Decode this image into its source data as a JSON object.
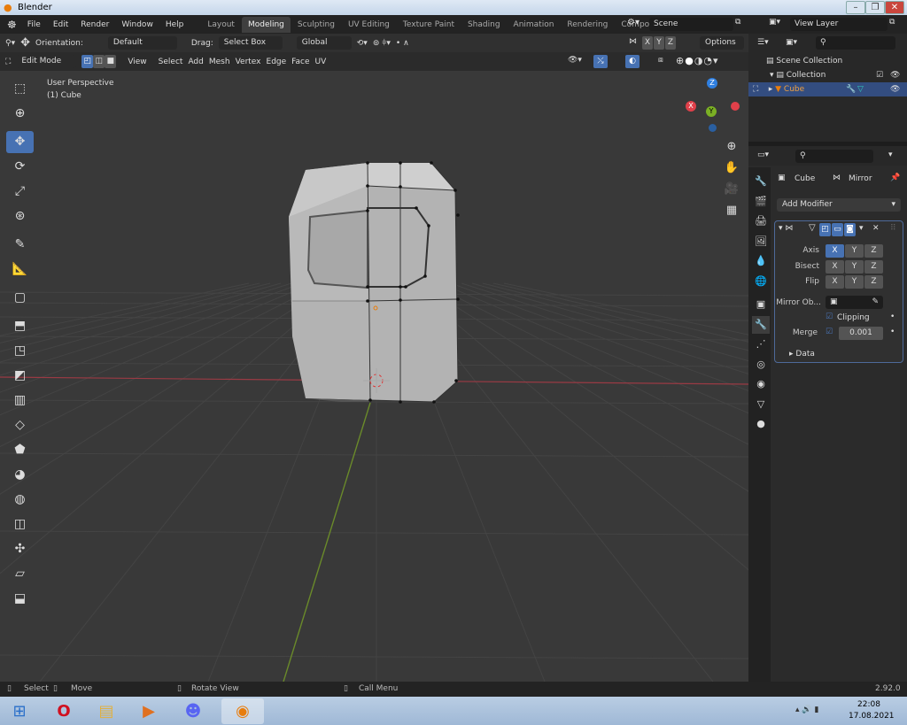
{
  "window": {
    "title": "Blender",
    "min": "–",
    "max": "❐",
    "close": "✕"
  },
  "menu": {
    "items": [
      "File",
      "Edit",
      "Render",
      "Window",
      "Help"
    ]
  },
  "workspaces": {
    "tabs": [
      "Layout",
      "Modeling",
      "Sculpting",
      "UV Editing",
      "Texture Paint",
      "Shading",
      "Animation",
      "Rendering",
      "Compositing"
    ],
    "active": "Modeling"
  },
  "scene": {
    "name": "Scene",
    "view_layer": "View Layer"
  },
  "tool_header": {
    "orientation_label": "Orientation:",
    "orientation": "Default",
    "drag_label": "Drag:",
    "drag": "Select Box",
    "transform": "Global",
    "axes": [
      "X",
      "Y",
      "Z"
    ],
    "options": "Options"
  },
  "edit_header": {
    "mode": "Edit Mode",
    "menus": [
      "View",
      "Select",
      "Add",
      "Mesh",
      "Vertex",
      "Edge",
      "Face",
      "UV"
    ]
  },
  "viewport": {
    "perspective": "User Perspective",
    "object": "(1) Cube",
    "gizmo": {
      "x": "X",
      "y": "Y",
      "z": "Z"
    },
    "axis_colors": {
      "x": "#e0404a",
      "y": "#7bb024",
      "z": "#2f7fe0"
    }
  },
  "toolbar": {
    "tools": [
      "select-box",
      "cursor",
      "move",
      "rotate",
      "scale",
      "transform",
      "annotate",
      "measure",
      "add-cube",
      "extrude",
      "inset",
      "bevel",
      "loop-cut",
      "knife",
      "poly-build",
      "spin",
      "smooth",
      "edge-slide",
      "shrink-fatten",
      "shear",
      "rip-region"
    ],
    "active": "move"
  },
  "outliner": {
    "items": [
      {
        "label": "Scene Collection"
      },
      {
        "label": "Collection"
      },
      {
        "label": "Cube",
        "selected": true
      }
    ]
  },
  "properties": {
    "object": "Cube",
    "modifier": "Mirror",
    "add_modifier": "Add Modifier",
    "axis_label": "Axis",
    "bisect_label": "Bisect",
    "flip_label": "Flip",
    "xyz": [
      "X",
      "Y",
      "Z"
    ],
    "axis_active": "X",
    "mirror_object_label": "Mirror Ob...",
    "clipping_label": "Clipping",
    "clipping": true,
    "merge_label": "Merge",
    "merge": true,
    "merge_value": "0.001",
    "data_label": "Data"
  },
  "status": {
    "select": "Select",
    "move": "Move",
    "rotate": "Rotate View",
    "call_menu": "Call Menu",
    "version": "2.92.0"
  },
  "taskbar": {
    "apps": [
      "start",
      "opera",
      "explorer",
      "media-player",
      "discord",
      "blender"
    ],
    "time": "22:08",
    "date": "17.08.2021"
  }
}
